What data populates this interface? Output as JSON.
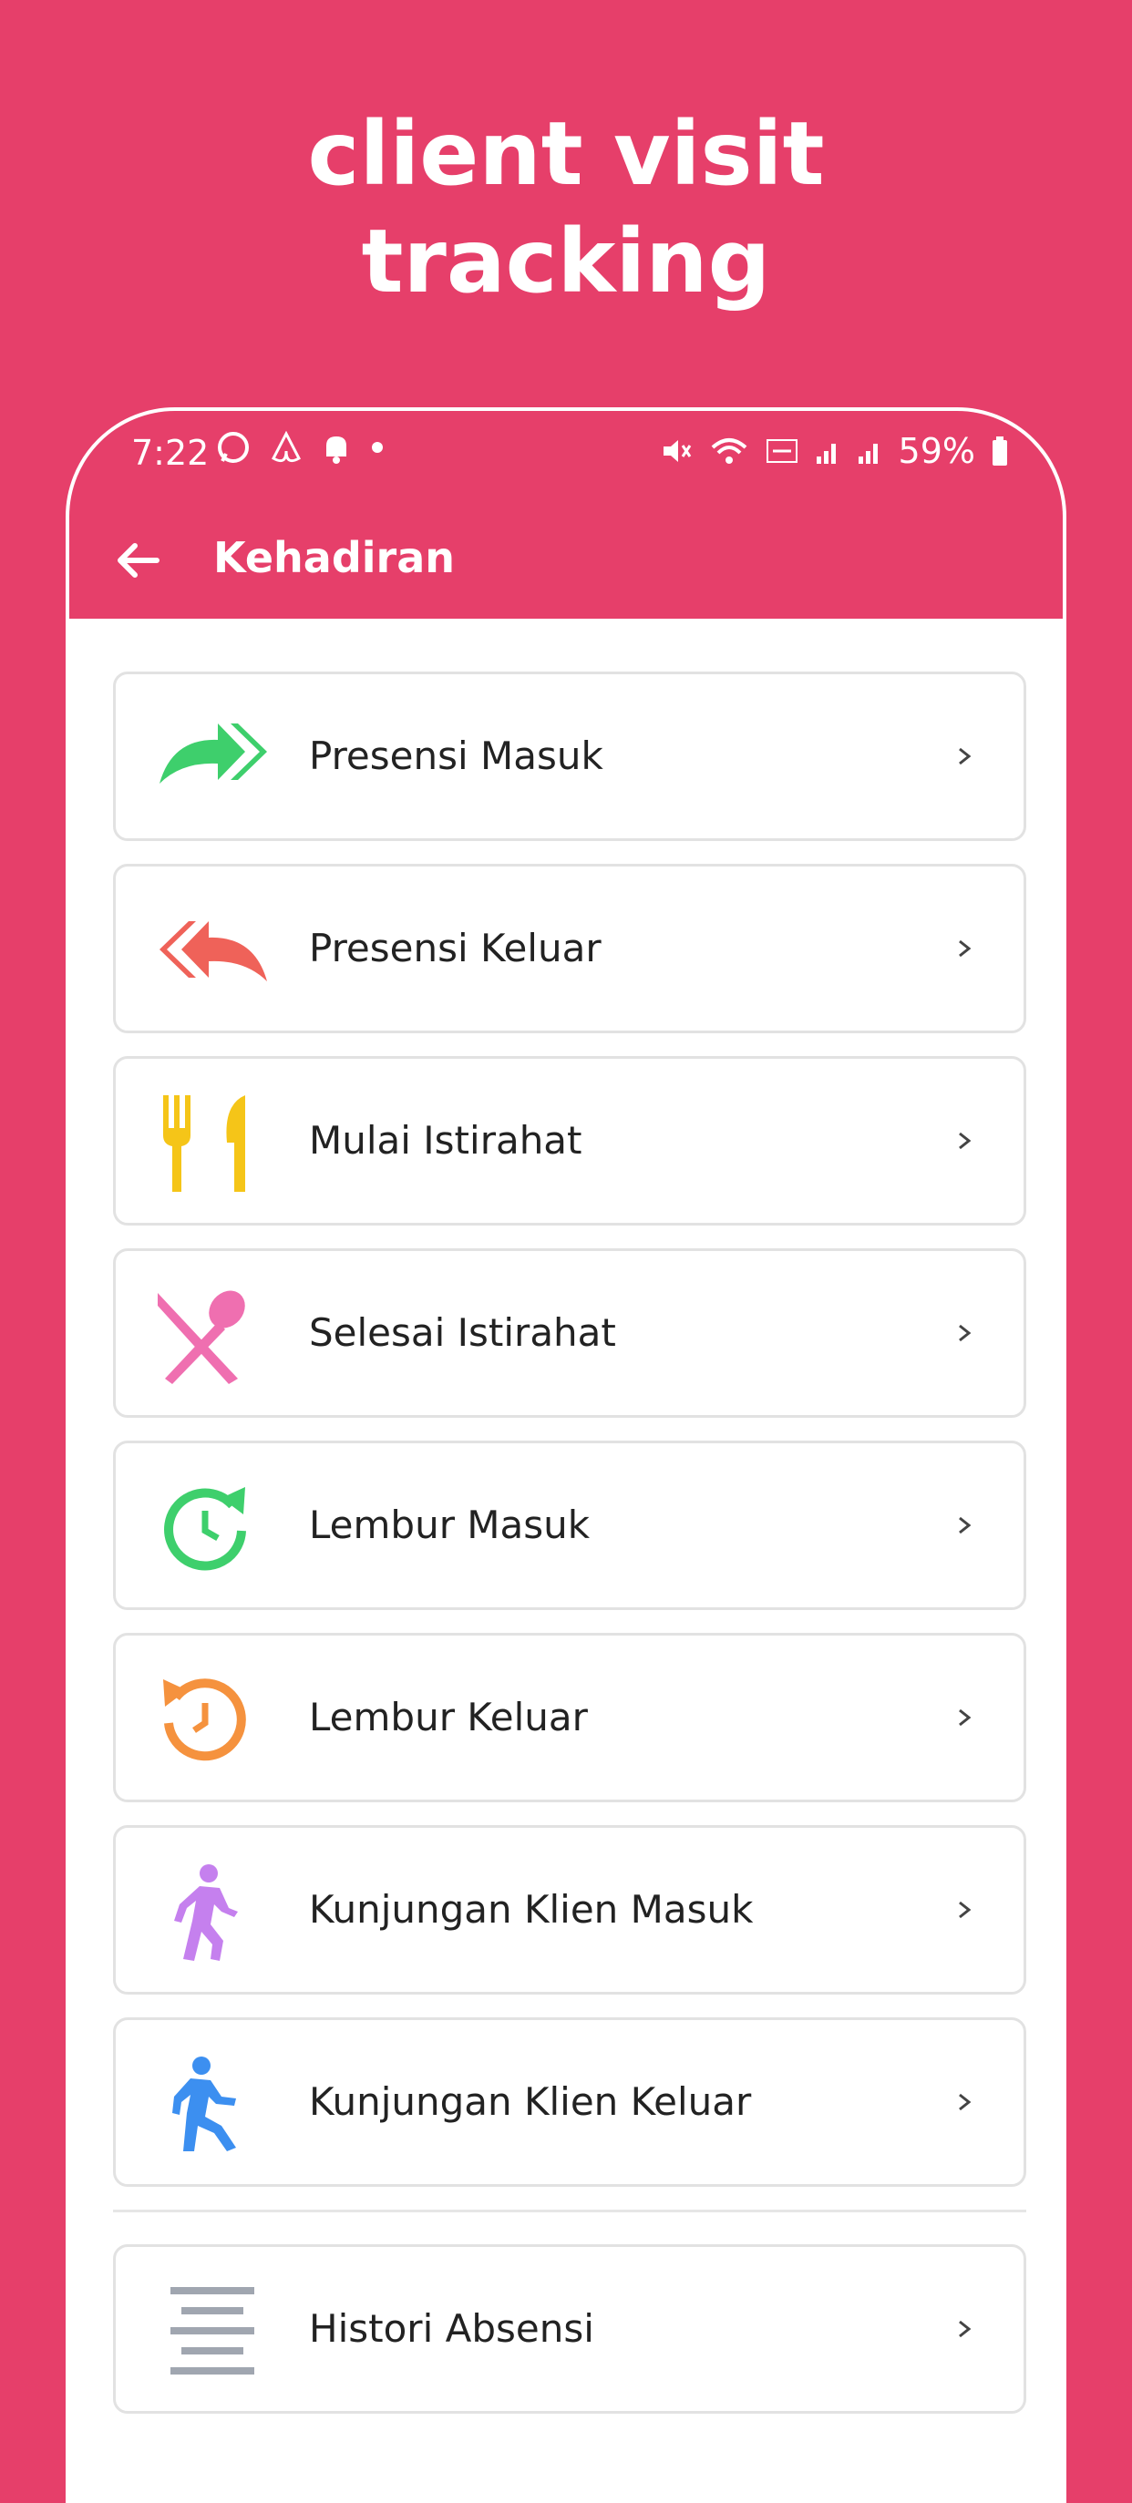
{
  "promo": {
    "title_line1": "client visit",
    "title_line2": "tracking"
  },
  "status_bar": {
    "time": "7:22",
    "battery": "59%"
  },
  "appbar": {
    "title": "Kehadiran"
  },
  "menu": [
    {
      "label": "Presensi Masuk",
      "icon": "forward-arrows-icon",
      "color": "#3ecf6c"
    },
    {
      "label": "Presensi Keluar",
      "icon": "reply-arrows-icon",
      "color": "#ef6259"
    },
    {
      "label": "Mulai Istirahat",
      "icon": "fork-knife-icon",
      "color": "#f5c518"
    },
    {
      "label": "Selesai Istirahat",
      "icon": "crossed-utensils-icon",
      "color": "#ef6fb0"
    },
    {
      "label": "Lembur Masuk",
      "icon": "clock-forward-icon",
      "color": "#3ecf6c"
    },
    {
      "label": "Lembur Keluar",
      "icon": "clock-history-icon",
      "color": "#f5923e"
    },
    {
      "label": "Kunjungan Klien Masuk",
      "icon": "walking-person-icon",
      "color": "#c580ee"
    },
    {
      "label": "Kunjungan Klien Keluar",
      "icon": "running-person-icon",
      "color": "#3c8ff0"
    }
  ],
  "history": {
    "label": "Histori Absensi",
    "icon": "lines-list-icon",
    "color": "#a0a6b0"
  }
}
